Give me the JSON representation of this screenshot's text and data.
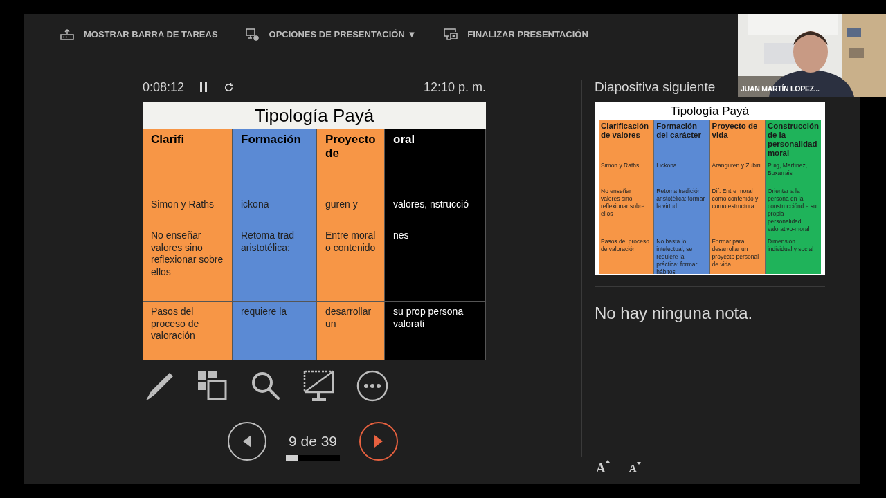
{
  "toolbar": [
    {
      "kind": "taskbar",
      "label": "MOSTRAR BARRA DE TAREAS"
    },
    {
      "kind": "options",
      "label": "OPCIONES DE PRESENTACIÓN ▼"
    },
    {
      "kind": "end",
      "label": "FINALIZAR PRESENTACIÓN"
    }
  ],
  "timer": {
    "elapsed": "0:08:12",
    "clock": "12:10 p. m."
  },
  "current_slide": {
    "title": "Tipología Payá",
    "columns": [
      {
        "color": "#f79646",
        "header": "Clarifi",
        "cells": [
          "Simon y Raths",
          "No enseñar valores sino reflexionar sobre ellos",
          "Pasos del proceso de valoración"
        ]
      },
      {
        "color": "#5b8ad4",
        "header": "Formación",
        "cells": [
          "ickona",
          "Retoma trad aristotélica:",
          "requiere la"
        ]
      },
      {
        "color": "#f79646",
        "header": "Proyecto de",
        "cells": [
          "guren y",
          "Entre moral o contenido",
          "desarrollar un"
        ]
      },
      {
        "color": "#000000",
        "header": "oral",
        "cells": [
          "valores, nstrucció",
          "nes",
          "su prop persona valorati"
        ]
      }
    ]
  },
  "tools": [
    {
      "kind": "pen"
    },
    {
      "kind": "slides"
    },
    {
      "kind": "zoom"
    },
    {
      "kind": "black"
    },
    {
      "kind": "more"
    }
  ],
  "navigation": {
    "counter": "9 de 39",
    "level": 0.23
  },
  "next_slide": {
    "heading": "Diapositiva siguiente",
    "title": "Tipología Payá",
    "columns": [
      {
        "color": "#f79646",
        "header": "Clarificación de valores",
        "cells": [
          "Simon y Raths",
          "No enseñar valores sino reflexionar sobre ellos",
          "Pasos del proceso de valoración"
        ]
      },
      {
        "color": "#5b8ad4",
        "header": "Formación del carácter",
        "cells": [
          "Lickona",
          "Retoma tradición aristotélica: formar la virtud",
          "No basta lo intelectual; se requiere la práctica: formar hábitos"
        ]
      },
      {
        "color": "#f79646",
        "header": "Proyecto de vida",
        "cells": [
          "Aranguren y Zubiri",
          "Dif. Entre moral como contenido y como estructura",
          "Formar para desarrollar un proyecto personal de vida"
        ]
      },
      {
        "color": "#1fb35a",
        "header": "Construcción de la personalidad moral",
        "cells": [
          "Puig, Martínez, Buxarrais",
          "Orientar a la persona en la construcciónd e su propia personalidad valorativo-moral",
          "Dimensión individual y social"
        ]
      }
    ]
  },
  "notes": {
    "text": "No hay ninguna nota."
  },
  "font_buttons": [
    {
      "kind": "larger",
      "label": "A"
    },
    {
      "kind": "smaller",
      "label": "A"
    }
  ],
  "webcam": {
    "name": "JUAN MARTÍN LOPEZ..."
  }
}
